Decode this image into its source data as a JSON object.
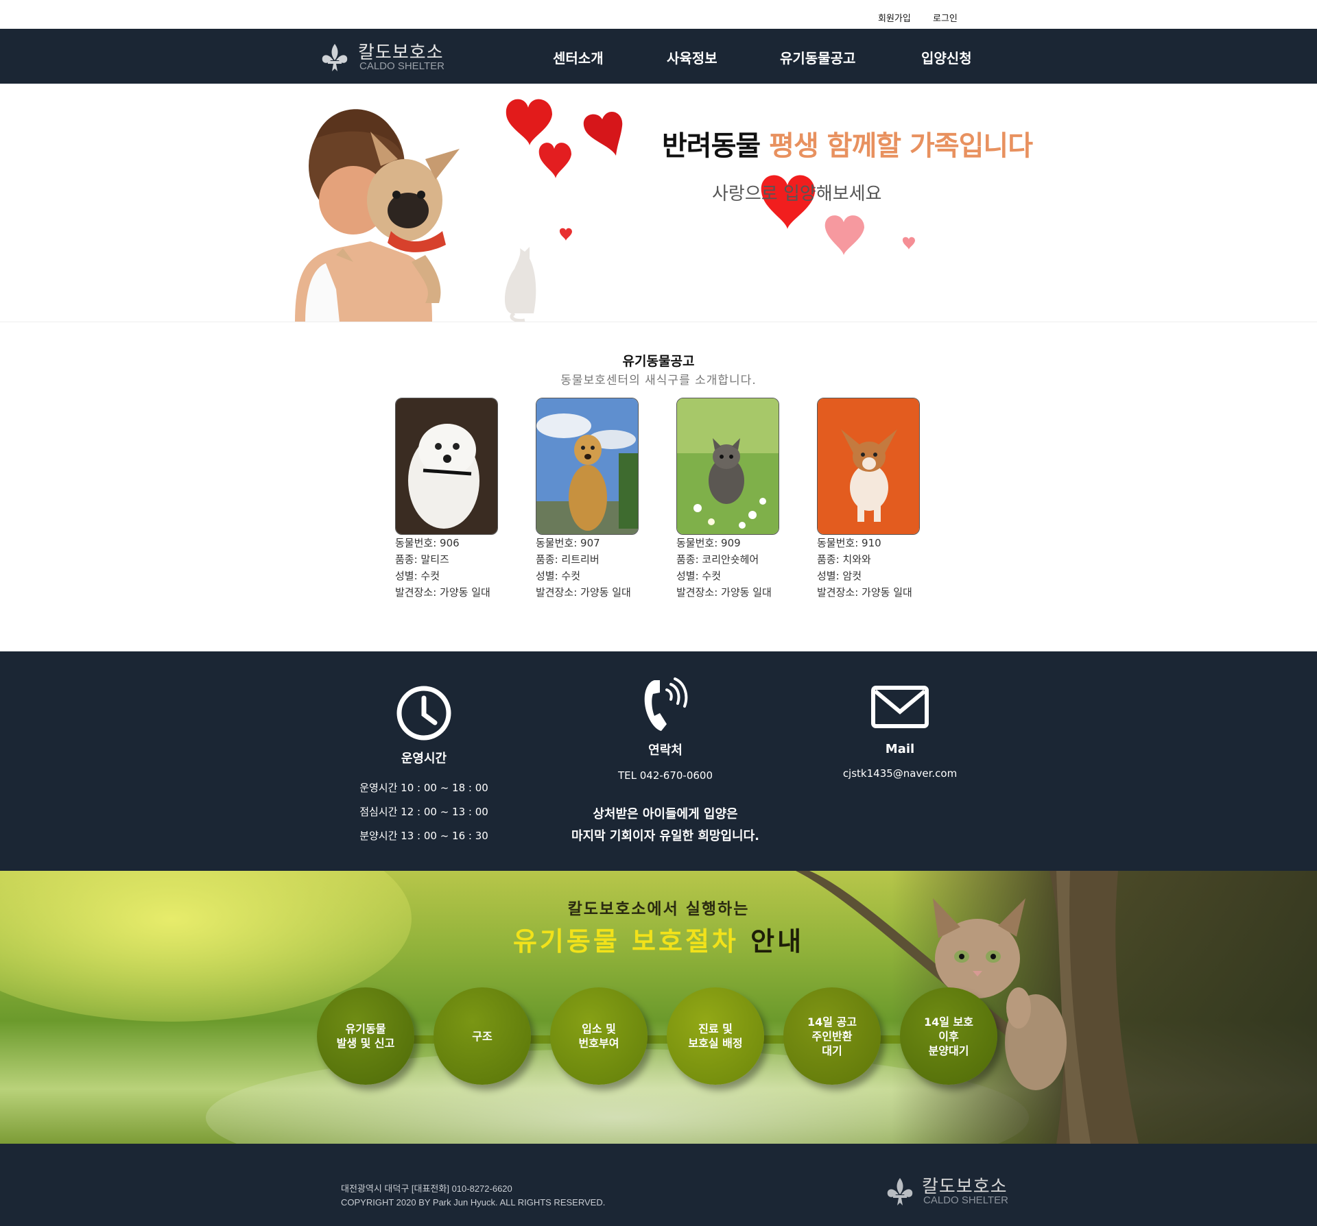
{
  "util_links": {
    "signup": "회원가입",
    "login": "로그인"
  },
  "brand": {
    "name_ko": "칼도보호소",
    "name_en": "CALDO SHELTER",
    "logo_icon": "fleur-de-lis-icon"
  },
  "nav": [
    "센터소개",
    "사육정보",
    "유기동물공고",
    "입양신청"
  ],
  "hero": {
    "tagline_black": "반려동물",
    "tagline_orange": "평생 함께할 가족입니다",
    "subtitle": "사랑으로 입양해보세요"
  },
  "notice": {
    "title": "유기동물공고",
    "subtitle": "동물보호센터의 새식구를 소개합니다.",
    "cards": [
      {
        "number": "동물번호: 906",
        "breed": "품종: 말티즈",
        "sex": "성별: 수컷",
        "place": "발견장소: 가양동 일대"
      },
      {
        "number": "동물번호: 907",
        "breed": "품종: 리트리버",
        "sex": "성별: 수컷",
        "place": "발견장소: 가양동 일대"
      },
      {
        "number": "동물번호: 909",
        "breed": "품종: 코리안숏헤어",
        "sex": "성별: 수컷",
        "place": "발견장소: 가양동 일대"
      },
      {
        "number": "동물번호: 910",
        "breed": "품종: 치와와",
        "sex": "성별: 암컷",
        "place": "발견장소: 가양동 일대"
      }
    ]
  },
  "info": {
    "hours": {
      "icon": "clock-icon",
      "title": "운영시간",
      "lines": [
        "운영시간 10 : 00 ~ 18 : 00",
        "점심시간 12 : 00 ~ 13 : 00",
        "분양시간 13 : 00 ~ 16 : 30"
      ]
    },
    "contact": {
      "icon": "phone-icon",
      "title": "연락처",
      "tel": "TEL 042-670-0600"
    },
    "mail": {
      "icon": "mail-icon",
      "title": "Mail",
      "address": "cjstk1435@naver.com"
    },
    "quote_line1": "상처받은 아이들에게 입양은",
    "quote_line2": "마지막 기회이자 유일한 희망입니다."
  },
  "procedure": {
    "kicker": "칼도보호소에서 실행하는",
    "title_yellow": "유기동물 보호절차",
    "title_dark": "안내",
    "steps": [
      "유기동물\n발생 및 신고",
      "구조",
      "입소 및\n번호부여",
      "진료 및\n보호실 배정",
      "14일 공고\n주인반환\n대기",
      "14일 보호\n이후\n분양대기"
    ]
  },
  "footer": {
    "address": "대전광역시 대덕구 [대표전화] 010-8272-6620",
    "copyright": "COPYRIGHT 2020 BY Park Jun Hyuck. ALL RIGHTS RESERVED."
  },
  "colors": {
    "header_bg": "#1b2634",
    "accent_orange": "#e8915f",
    "accent_yellow": "#f2e21a"
  }
}
